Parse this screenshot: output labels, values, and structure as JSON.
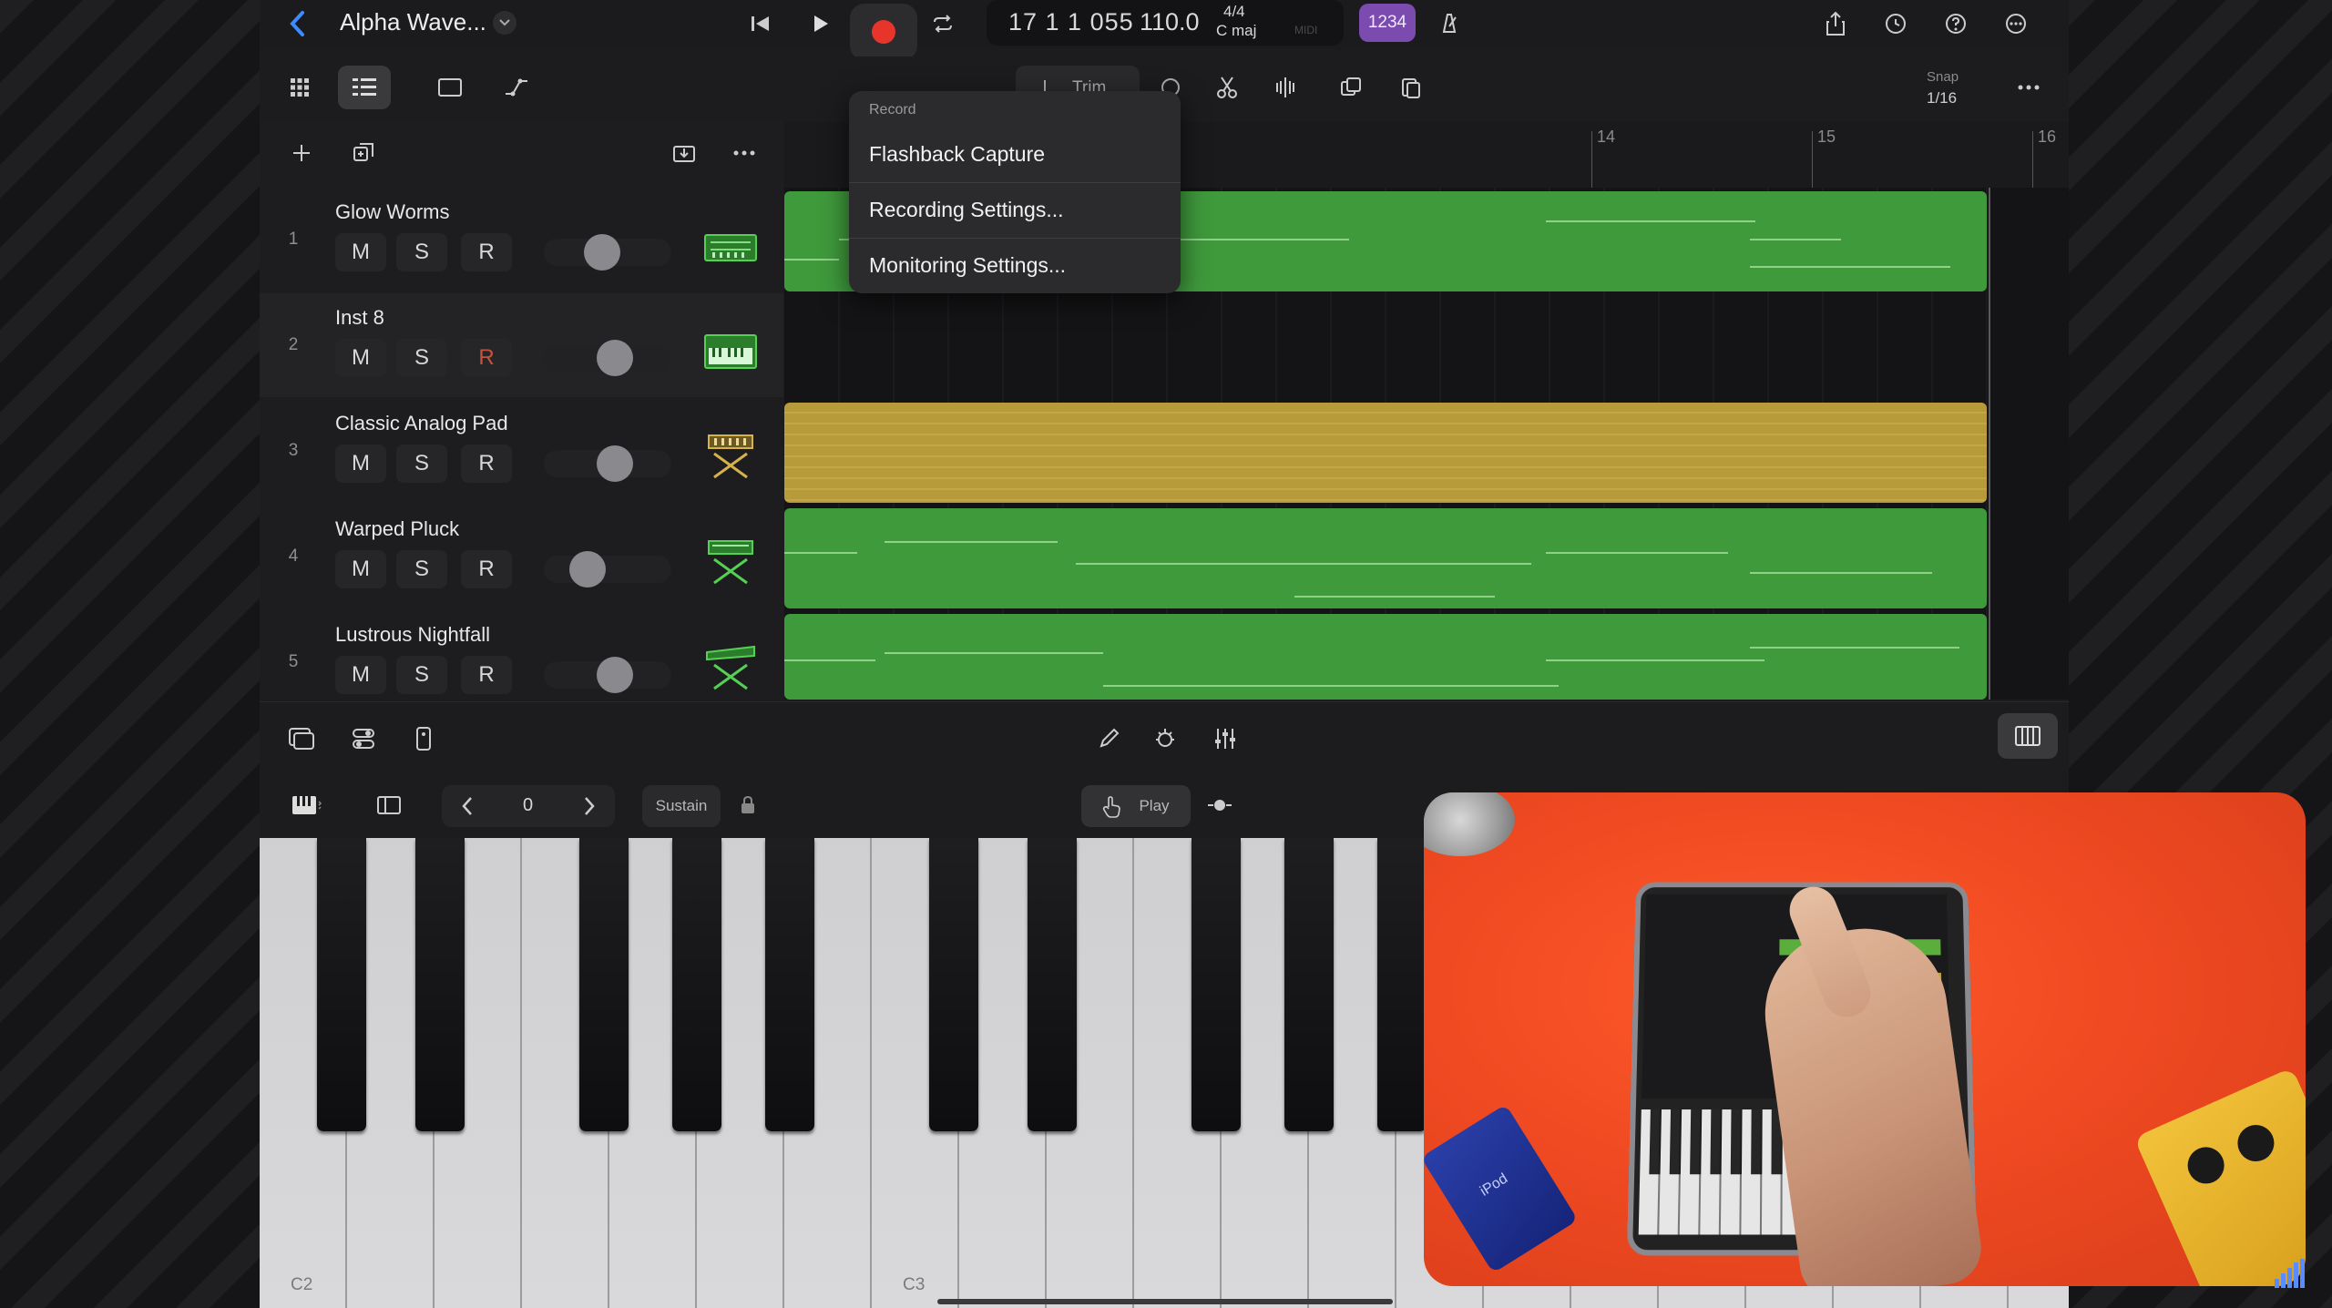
{
  "header": {
    "project_title": "Alpha Wave...",
    "lcd_position": "17 1 1 055",
    "lcd_tempo": "110.0",
    "lcd_signature": "4/4",
    "lcd_key": "C maj",
    "lcd_midi": "MIDI",
    "count_in": "1234"
  },
  "toolbar": {
    "trim_label": "Trim",
    "snap_label": "Snap",
    "snap_value": "1/16"
  },
  "ruler": {
    "bars": [
      "14",
      "15",
      "16"
    ]
  },
  "tracks": [
    {
      "number": "1",
      "name": "Glow Worms",
      "mute": "M",
      "solo": "S",
      "rec": "R"
    },
    {
      "number": "2",
      "name": "Inst 8",
      "mute": "M",
      "solo": "S",
      "rec": "R"
    },
    {
      "number": "3",
      "name": "Classic Analog Pad",
      "mute": "M",
      "solo": "S",
      "rec": "R"
    },
    {
      "number": "4",
      "name": "Warped Pluck",
      "mute": "M",
      "solo": "S",
      "rec": "R"
    },
    {
      "number": "5",
      "name": "Lustrous Nightfall",
      "mute": "M",
      "solo": "S",
      "rec": "R"
    }
  ],
  "record_menu": {
    "title": "Record",
    "items": [
      "Flashback Capture",
      "Recording Settings...",
      "Monitoring Settings..."
    ]
  },
  "keyboard_bar": {
    "octave": "0",
    "sustain": "Sustain",
    "play": "Play"
  },
  "keyboard": {
    "labels": [
      "C2",
      "C3"
    ]
  },
  "webcam": {
    "device_label": "iPod"
  },
  "colors": {
    "region_green": "#3f9a3c",
    "region_yellow": "#b79a3a",
    "record_red": "#e8352b",
    "count_in_purple": "#7b4bb0",
    "back_blue": "#3d8cff"
  }
}
